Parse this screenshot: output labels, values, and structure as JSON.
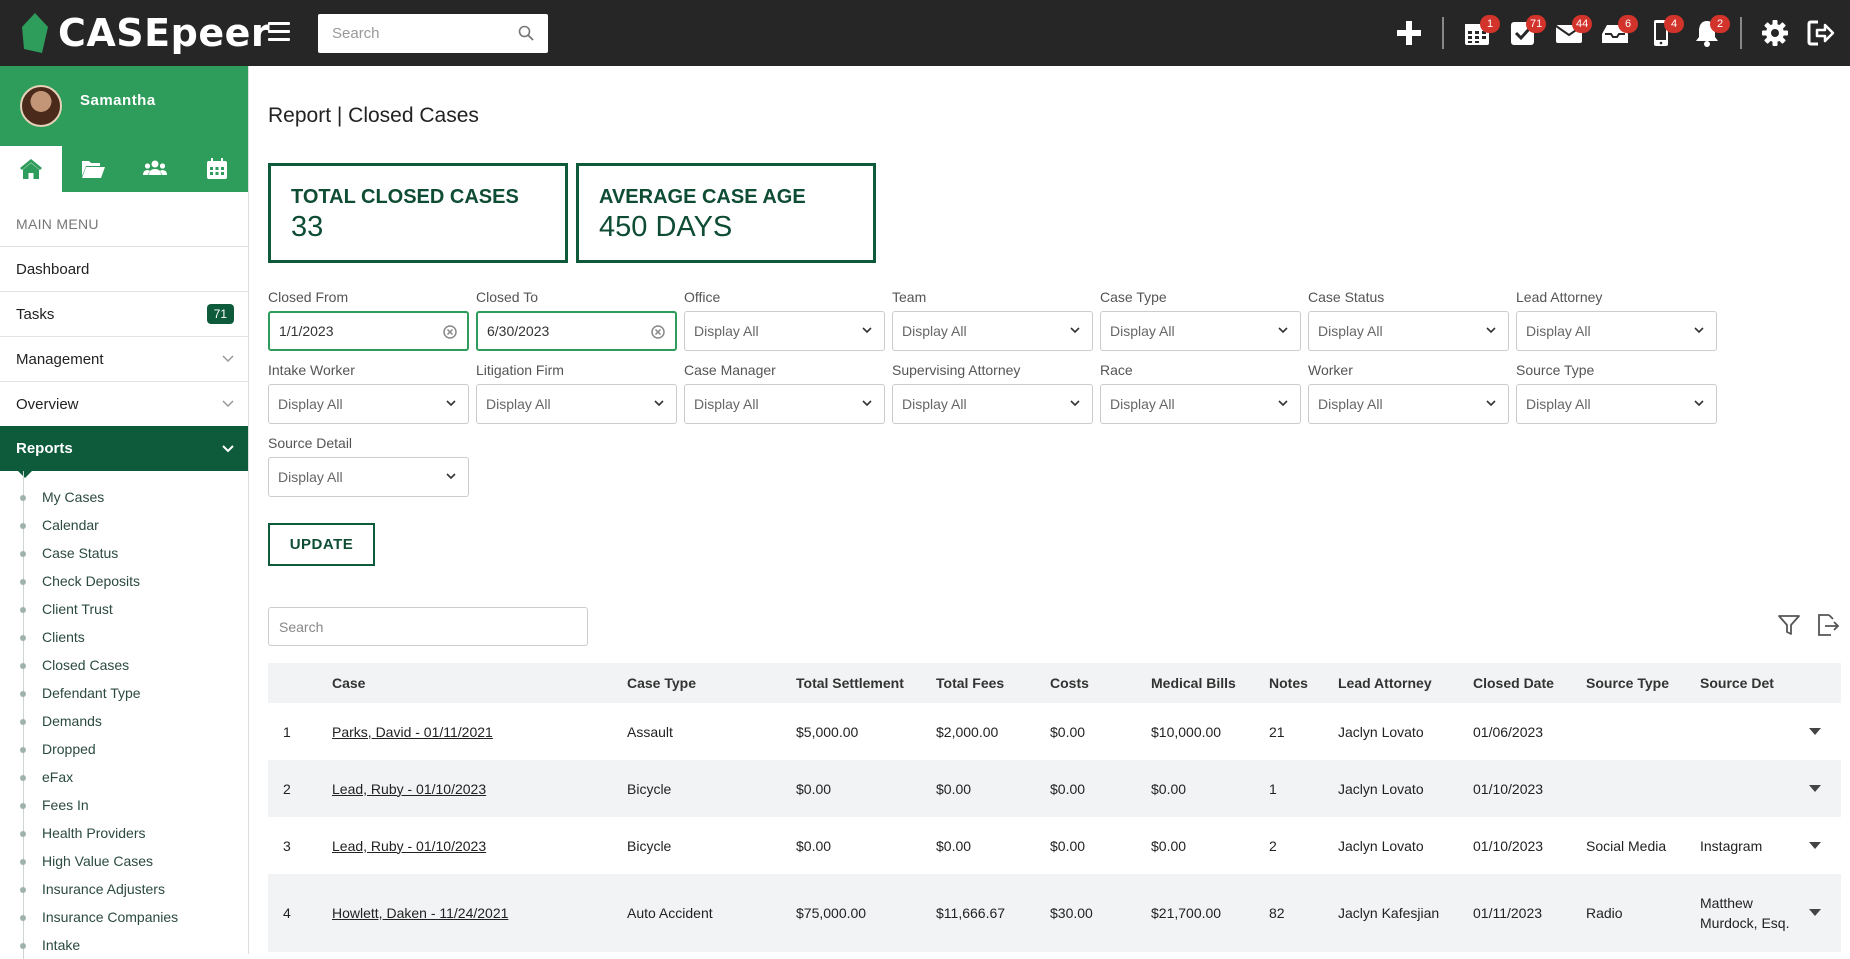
{
  "app": {
    "logo_text": "CASEpeer",
    "search_placeholder": "Search"
  },
  "topbar": {
    "badges": {
      "calendar": "1",
      "tasks": "71",
      "mail": "44",
      "inbox": "6",
      "phone": "4",
      "bell": "2"
    }
  },
  "sidebar": {
    "user_name": "Samantha",
    "menu_title": "MAIN MENU",
    "items": [
      {
        "label": "Dashboard"
      },
      {
        "label": "Tasks",
        "count": "71"
      },
      {
        "label": "Management"
      },
      {
        "label": "Overview"
      },
      {
        "label": "Reports"
      }
    ],
    "reports_sub": [
      "My Cases",
      "Calendar",
      "Case Status",
      "Check Deposits",
      "Client Trust",
      "Clients",
      "Closed Cases",
      "Defendant Type",
      "Demands",
      "Dropped",
      "eFax",
      "Fees In",
      "Health Providers",
      "High Value Cases",
      "Insurance Adjusters",
      "Insurance Companies",
      "Intake"
    ]
  },
  "page": {
    "title": "Report | Closed Cases",
    "stats": {
      "total_label": "TOTAL CLOSED CASES",
      "total_value": "33",
      "avg_label": "AVERAGE CASE AGE",
      "avg_value": "450 DAYS"
    },
    "filters": [
      {
        "label": "Closed From",
        "value": "1/1/2023"
      },
      {
        "label": "Closed To",
        "value": "6/30/2023"
      },
      {
        "label": "Office",
        "value": "Display All"
      },
      {
        "label": "Team",
        "value": "Display All"
      },
      {
        "label": "Case Type",
        "value": "Display All"
      },
      {
        "label": "Case Status",
        "value": "Display All"
      },
      {
        "label": "Lead Attorney",
        "value": "Display All"
      },
      {
        "label": "Intake Worker",
        "value": "Display All"
      },
      {
        "label": "Litigation Firm",
        "value": "Display All"
      },
      {
        "label": "Case Manager",
        "value": "Display All"
      },
      {
        "label": "Supervising Attorney",
        "value": "Display All"
      },
      {
        "label": "Race",
        "value": "Display All"
      },
      {
        "label": "Worker",
        "value": "Display All"
      },
      {
        "label": "Source Type",
        "value": "Display All"
      },
      {
        "label": "Source Detail",
        "value": "Display All"
      }
    ],
    "update_label": "UPDATE",
    "table_search_placeholder": "Search"
  },
  "table": {
    "headers": [
      "",
      "Case",
      "Case Type",
      "Total Settlement",
      "Total Fees",
      "Costs",
      "Medical Bills",
      "Notes",
      "Lead Attorney",
      "Closed Date",
      "Source Type",
      "Source Det"
    ],
    "rows": [
      [
        "1",
        "Parks, David - 01/11/2021",
        "Assault",
        "$5,000.00",
        "$2,000.00",
        "$0.00",
        "$10,000.00",
        "21",
        "Jaclyn Lovato",
        "01/06/2023",
        "",
        ""
      ],
      [
        "2",
        "Lead, Ruby - 01/10/2023",
        "Bicycle",
        "$0.00",
        "$0.00",
        "$0.00",
        "$0.00",
        "1",
        "Jaclyn Lovato",
        "01/10/2023",
        "",
        ""
      ],
      [
        "3",
        "Lead, Ruby - 01/10/2023",
        "Bicycle",
        "$0.00",
        "$0.00",
        "$0.00",
        "$0.00",
        "2",
        "Jaclyn Lovato",
        "01/10/2023",
        "Social Media",
        "Instagram"
      ],
      [
        "4",
        "Howlett, Daken - 11/24/2021",
        "Auto Accident",
        "$75,000.00",
        "$11,666.67",
        "$30.00",
        "$21,700.00",
        "82",
        "Jaclyn Kafesjian",
        "01/11/2023",
        "Radio",
        "Matthew Murdock, Esq."
      ]
    ]
  },
  "colors": {
    "brand_green": "#2e9c5a",
    "dark_green": "#0e5b3c",
    "topbar": "#262626",
    "badge_red": "#d2332b"
  }
}
